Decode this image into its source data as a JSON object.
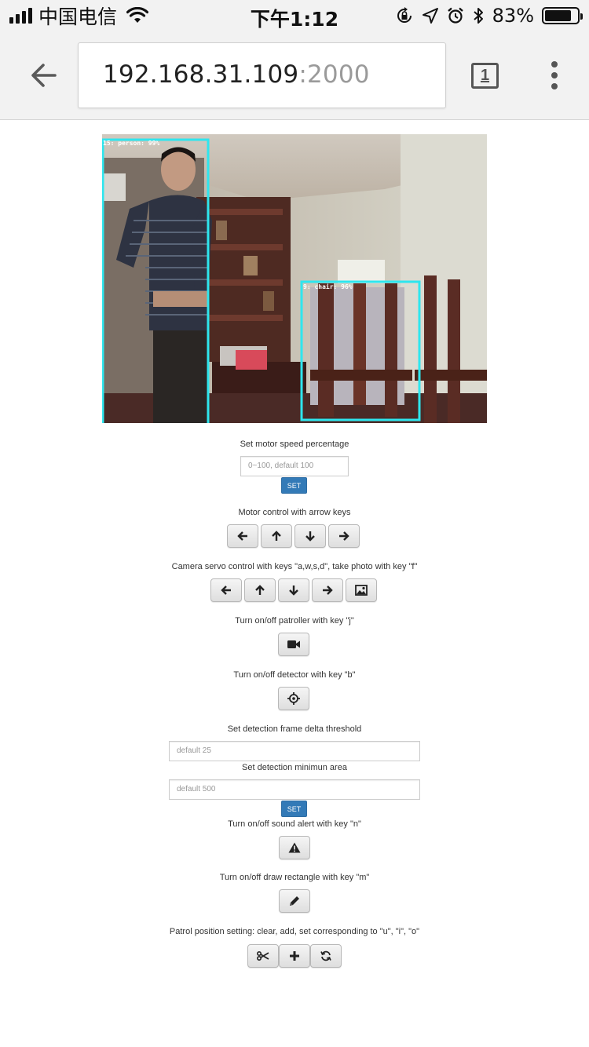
{
  "status_bar": {
    "carrier": "中国电信",
    "time": "下午1:12",
    "battery": "83%",
    "battery_level": 0.83
  },
  "browser": {
    "url_host": "192.168.31.109",
    "url_port": ":2000",
    "tab_count": "1"
  },
  "camera": {
    "detections": [
      {
        "label": "15: person: 99%"
      },
      {
        "label": "9: chair: 96%"
      }
    ],
    "box_color": "#2ee6ee"
  },
  "motor_speed": {
    "label": "Set motor speed percentage",
    "placeholder": "0~100, default 100",
    "set_label": "SET"
  },
  "motor_control": {
    "label": "Motor control with arrow keys",
    "buttons": [
      "arrow-left-icon",
      "arrow-up-icon",
      "arrow-down-icon",
      "arrow-right-icon"
    ]
  },
  "camera_servo": {
    "label": "Camera servo control with keys \"a,w,s,d\", take photo with key \"f\"",
    "buttons": [
      "arrow-left-icon",
      "arrow-up-icon",
      "arrow-down-icon",
      "arrow-right-icon",
      "picture-icon"
    ]
  },
  "patroller": {
    "label": "Turn on/off patroller with key \"j\"",
    "icon": "video-camera-icon"
  },
  "detector": {
    "label": "Turn on/off detector with key \"b\"",
    "icon": "screenshot-icon"
  },
  "detection_threshold": {
    "label": "Set detection frame delta threshold",
    "placeholder": "default 25"
  },
  "detection_area": {
    "label": "Set detection minimun area",
    "placeholder": "default 500",
    "set_label": "SET"
  },
  "sound_alert": {
    "label": "Turn on/off sound alert with key \"n\"",
    "icon": "warning-icon"
  },
  "draw_rectangle": {
    "label": "Turn on/off draw rectangle with key \"m\"",
    "icon": "pencil-icon"
  },
  "patrol_position": {
    "label": "Patrol position setting: clear, add, set corresponding to \"u\", \"i\", \"o\"",
    "buttons": [
      "scissors-icon",
      "plus-icon",
      "refresh-icon"
    ]
  },
  "colors": {
    "primary": "#337ab7",
    "chrome_bg": "#f2f2f2"
  }
}
